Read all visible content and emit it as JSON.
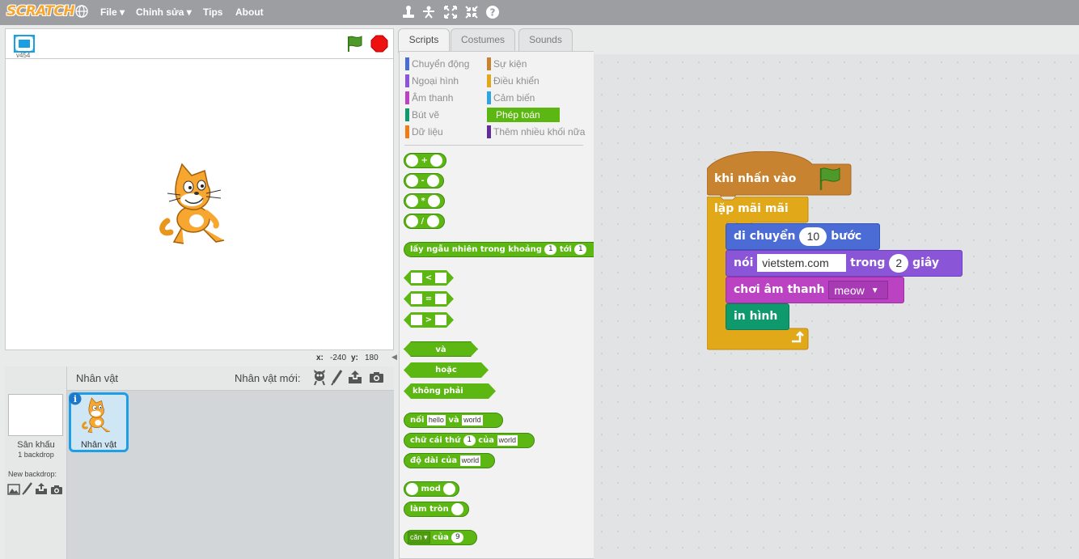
{
  "menubar": {
    "logo": "SCRATCH",
    "items": [
      "File",
      "Chỉnh sửa",
      "Tips",
      "About"
    ],
    "file_label": "File",
    "edit_label": "Chỉnh sửa",
    "tips_label": "Tips",
    "about_label": "About"
  },
  "stage": {
    "version": "v454",
    "x_label": "x:",
    "x_value": "-240",
    "y_label": "y:",
    "y_value": "180"
  },
  "sprites": {
    "header_title": "Nhân vật",
    "new_sprite_label": "Nhân vật mới:",
    "stage_name": "Sân khấu",
    "stage_backdrops": "1 backdrop",
    "new_backdrop_label": "New backdrop:",
    "sprite_name": "Nhân vật"
  },
  "tabs": {
    "scripts": "Scripts",
    "costumes": "Costumes",
    "sounds": "Sounds"
  },
  "categories": {
    "motion": "Chuyển động",
    "looks": "Ngoại hình",
    "sound": "Âm thanh",
    "pen": "Bút vẽ",
    "data": "Dữ liệu",
    "events": "Sự kiện",
    "control": "Điều khiển",
    "sensing": "Cảm biến",
    "operators": "Phép toán",
    "more": "Thêm nhiều khối nữa"
  },
  "palette": {
    "op_plus": "+",
    "op_minus": "-",
    "op_times": "*",
    "op_div": "/",
    "random_pre": "lấy ngẫu nhiên trong khoảng",
    "random_from": "1",
    "random_mid": "tới",
    "random_to": "1",
    "lt": "<",
    "eq": "=",
    "gt": ">",
    "and": "và",
    "or": "hoặc",
    "not": "không phải",
    "join_label": "nối",
    "join_a": "hello",
    "join_mid": "và",
    "join_b": "world",
    "letter_label": "chữ cái thứ",
    "letter_n": "1",
    "letter_of": "của",
    "letter_word": "world",
    "length_label": "độ dài của",
    "length_word": "world",
    "mod_label": "mod",
    "round_label": "làm tròn",
    "func_value": "căn",
    "func_of": "của",
    "func_n": "9"
  },
  "script": {
    "hat_label": "khi nhấn vào",
    "forever_label": "lặp mãi mãi",
    "move_label": "di chuyển",
    "move_steps": "10",
    "move_unit": "bước",
    "say_label": "nói",
    "say_text": "vietstem.com",
    "say_for": "trong",
    "say_secs": "2",
    "say_unit": "giây",
    "play_label": "chơi âm thanh",
    "play_sound": "meow",
    "stamp_label": "in hình"
  },
  "colors": {
    "motion": "#4a6cd4",
    "looks": "#8a55d7",
    "sound": "#bb42c3",
    "pen": "#0e9a6c",
    "data": "#ee7d16",
    "events": "#c88330",
    "control": "#e1a91a",
    "sensing": "#2ca5e2",
    "operators": "#5cb712",
    "more": "#632d99"
  }
}
